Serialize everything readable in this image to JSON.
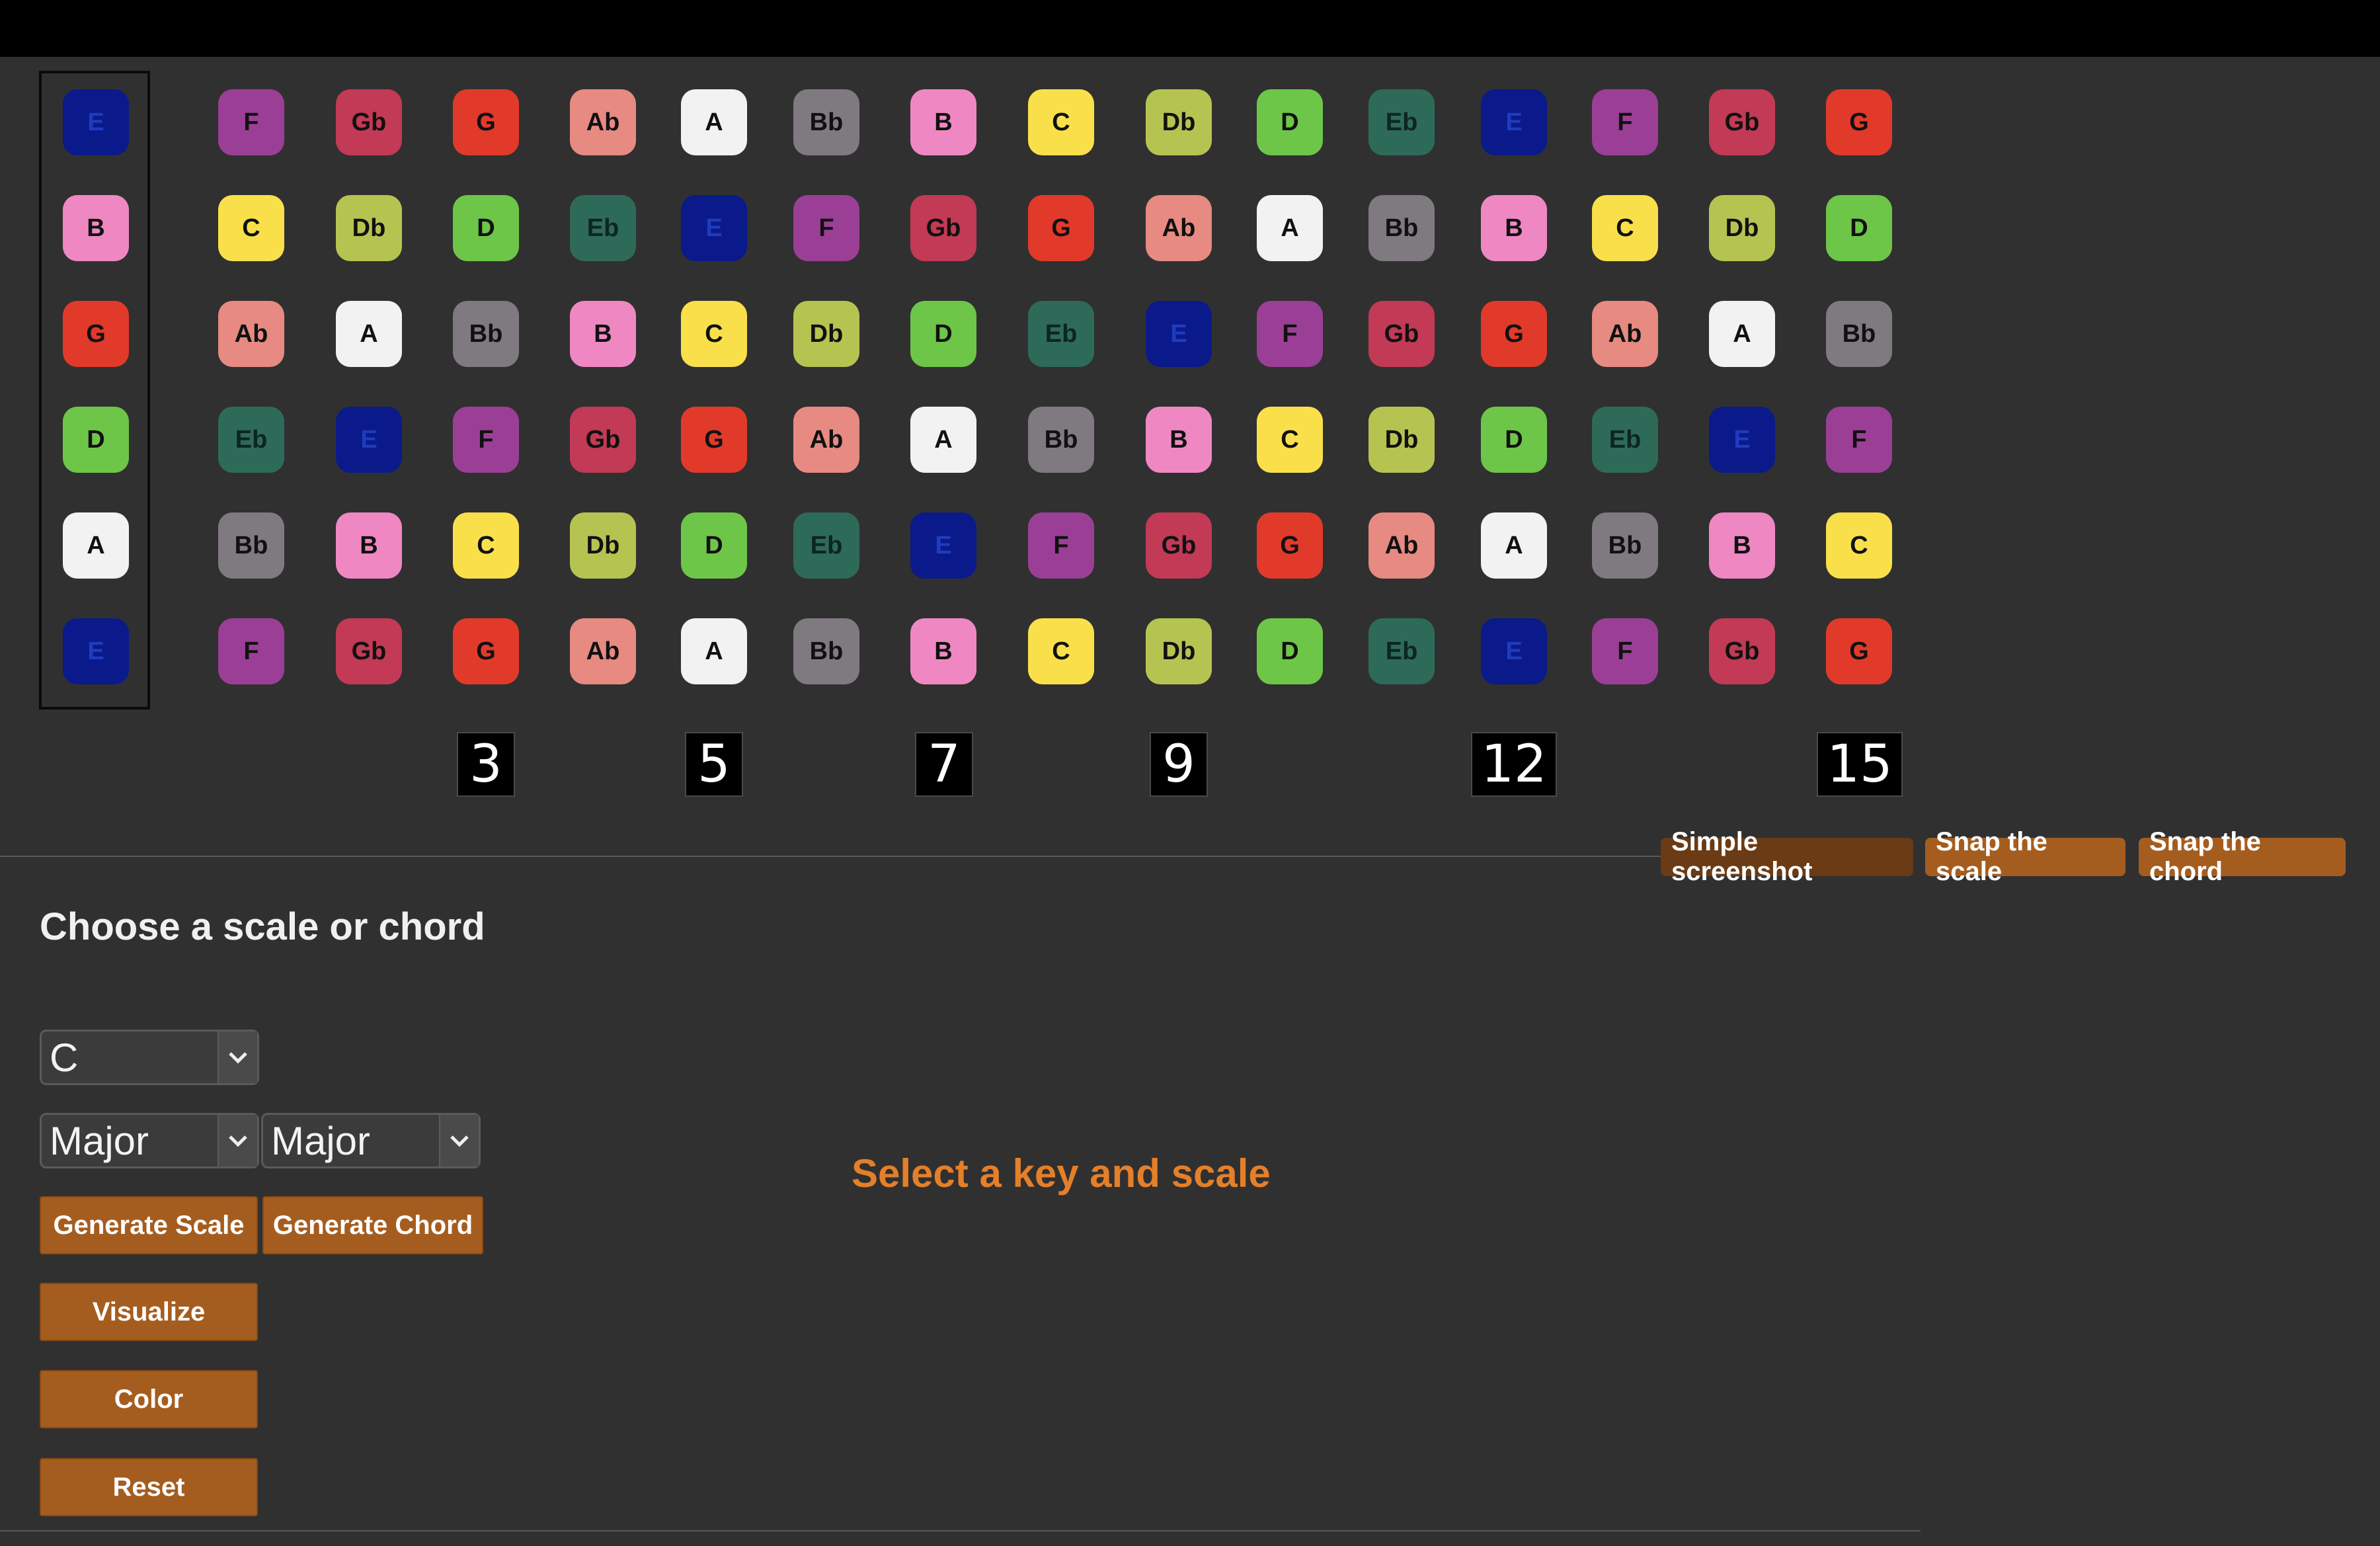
{
  "colors": {
    "C": "#f9e04b",
    "Db": "#b5c451",
    "D": "#6ec648",
    "Eb": "#2e6a58",
    "E": "#0a1a8a",
    "F": "#9b3f96",
    "Gb": "#c23a55",
    "G": "#e23a2a",
    "Ab": "#e68a82",
    "A": "#f2f2f2",
    "Bb": "#7f7a80",
    "B": "#ef88c2"
  },
  "open_strings": [
    "E",
    "B",
    "G",
    "D",
    "A",
    "E"
  ],
  "fretboard": [
    [
      "F",
      "Gb",
      "G",
      "Ab",
      "A",
      "Bb",
      "B",
      "C",
      "Db",
      "D",
      "Eb",
      "E",
      "F",
      "Gb",
      "G"
    ],
    [
      "C",
      "Db",
      "D",
      "Eb",
      "E",
      "F",
      "Gb",
      "G",
      "Ab",
      "A",
      "Bb",
      "B",
      "C",
      "Db",
      "D"
    ],
    [
      "Ab",
      "A",
      "Bb",
      "B",
      "C",
      "Db",
      "D",
      "Eb",
      "E",
      "F",
      "Gb",
      "G",
      "Ab",
      "A",
      "Bb"
    ],
    [
      "Eb",
      "E",
      "F",
      "Gb",
      "G",
      "Ab",
      "A",
      "Bb",
      "B",
      "C",
      "Db",
      "D",
      "Eb",
      "E",
      "F"
    ],
    [
      "Bb",
      "B",
      "C",
      "Db",
      "D",
      "Eb",
      "E",
      "F",
      "Gb",
      "G",
      "Ab",
      "A",
      "Bb",
      "B",
      "C"
    ],
    [
      "F",
      "Gb",
      "G",
      "Ab",
      "A",
      "Bb",
      "B",
      "C",
      "Db",
      "D",
      "Eb",
      "E",
      "F",
      "Gb",
      "G"
    ]
  ],
  "fret_markers": [
    "3",
    "5",
    "7",
    "9",
    "12",
    "15"
  ],
  "snap_buttons": {
    "simple": "Simple screenshot",
    "scale": "Snap the scale",
    "chord": "Snap the chord"
  },
  "panel": {
    "title": "Choose a scale or chord",
    "key_select": "C",
    "scale_select": "Major",
    "chord_select": "Major",
    "generate_scale": "Generate Scale",
    "generate_chord": "Generate Chord",
    "visualize": "Visualize",
    "color": "Color",
    "reset": "Reset"
  },
  "status": "Select a key and scale"
}
